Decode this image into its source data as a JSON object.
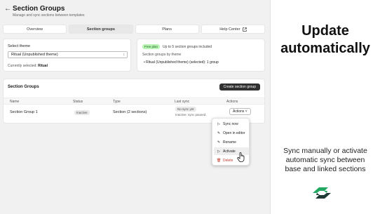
{
  "header": {
    "back_icon": "arrow-left-icon",
    "title": "Section Groups",
    "subtitle": "Manage and sync sections between templates"
  },
  "tabs": [
    {
      "label": "Overview",
      "active": false
    },
    {
      "label": "Section groups",
      "active": true
    },
    {
      "label": "Plans",
      "active": false
    },
    {
      "label": "Help Center",
      "active": false,
      "icon": "external-link-icon"
    }
  ],
  "theme": {
    "label": "Select theme",
    "selected": "Ritual (Unpublished theme)",
    "current_prefix": "Currently selected:",
    "current_value": "Ritual"
  },
  "plan": {
    "badge": "Free plan",
    "text": "Up to 5 section groups included",
    "by_theme": "Section groups by theme",
    "item": "Ritual (Unpublished theme) (selected): 1 group"
  },
  "groups": {
    "title": "Section Groups",
    "create_label": "Create section group",
    "columns": [
      "Name",
      "Status",
      "Type",
      "Last sync",
      "Actions"
    ],
    "row": {
      "name": "Section Group 1",
      "status": "Inactive",
      "type": "Section (2 sections)",
      "sync_badge": "No sync yet",
      "sync_note": "Inactive: sync paused.",
      "actions_label": "Actions"
    }
  },
  "menu": {
    "items": [
      {
        "label": "Sync now",
        "icon": "play-icon"
      },
      {
        "label": "Open in editor",
        "icon": "pencil-icon"
      },
      {
        "label": "Rename",
        "icon": "pencil-icon"
      },
      {
        "label": "Activate",
        "icon": "play-icon"
      },
      {
        "label": "Delete",
        "icon": "trash-icon"
      }
    ]
  },
  "promo": {
    "headline_line1": "Update",
    "headline_line2": "automatically",
    "desc_line1": "Sync manually or activate",
    "desc_line2": "automatic sync between",
    "desc_line3": "base and linked sections"
  },
  "colors": {
    "accent_dark": "#303030",
    "free_badge": "#b9f5b5",
    "danger": "#c0392b",
    "logo_green": "#22a861"
  }
}
